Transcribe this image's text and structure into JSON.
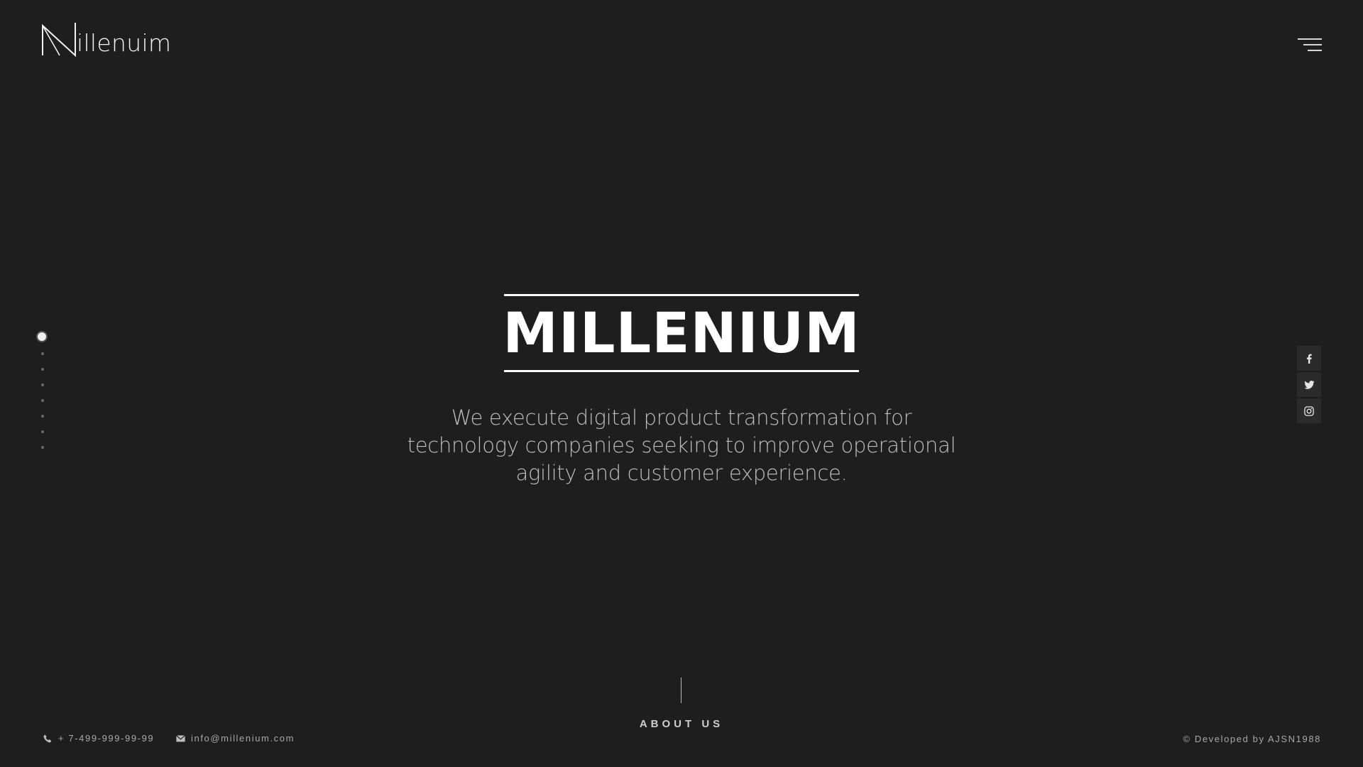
{
  "brand": {
    "logo_text": "illenuim"
  },
  "hero": {
    "title": "MILLENIUM",
    "subtitle": "We execute digital product transformation for technology companies seeking to improve operational agility and customer experience."
  },
  "pager": {
    "count": 8,
    "active_index": 0
  },
  "social": [
    {
      "icon": "facebook-icon",
      "glyph": "f"
    },
    {
      "icon": "twitter-icon",
      "glyph": "t"
    },
    {
      "icon": "instagram-icon",
      "glyph": "i"
    }
  ],
  "scroll_hint": {
    "label": "ABOUT US"
  },
  "footer": {
    "phone": "+ 7-499-999-99-99",
    "email": "info@millenium.com",
    "copyright": "© Developed by AJSN1988"
  },
  "colors": {
    "background": "#1e1e1e",
    "text": "#ffffff",
    "muted": "#a8a8a8"
  }
}
